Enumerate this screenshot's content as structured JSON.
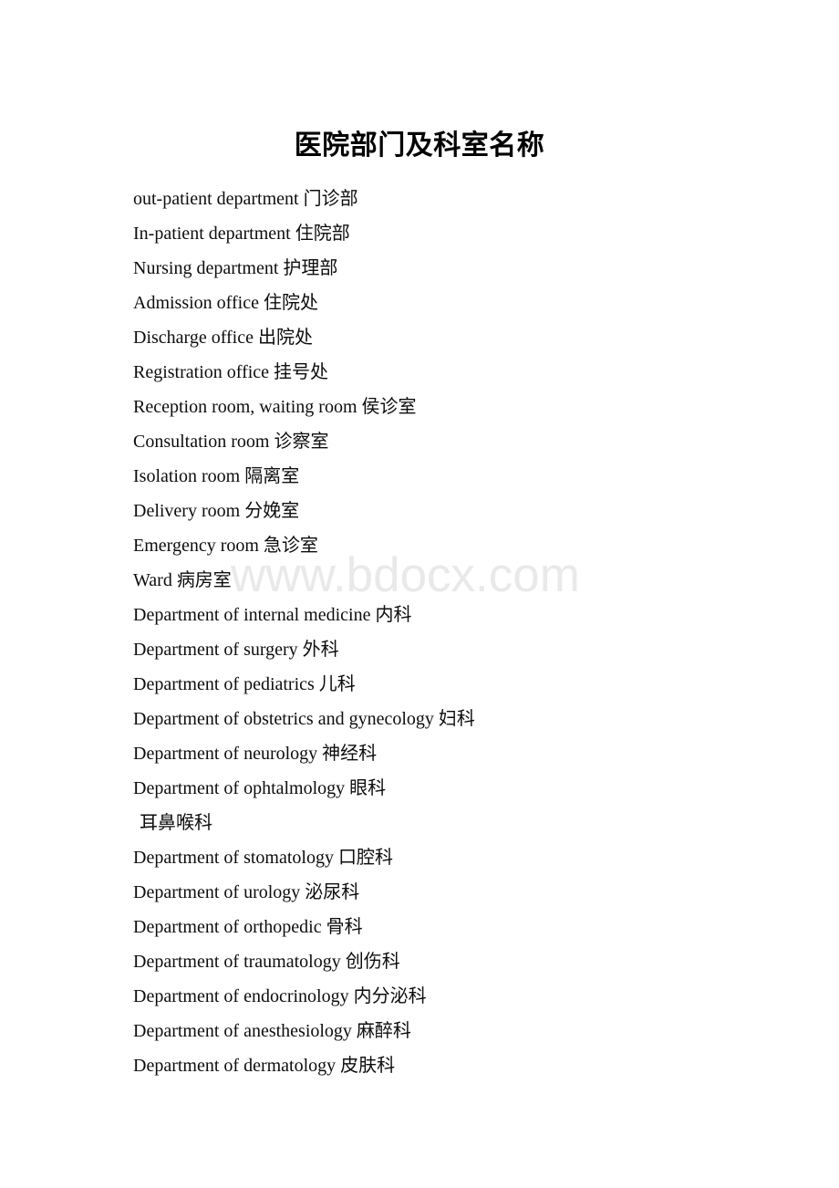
{
  "document": {
    "title": "医院部门及科室名称",
    "watermark": "www.bdocx.com",
    "lines": [
      {
        "text": "out-patient department 门诊部",
        "indent": false
      },
      {
        "text": "In-patient department 住院部",
        "indent": false
      },
      {
        "text": "Nursing department 护理部",
        "indent": false
      },
      {
        "text": "Admission office 住院处",
        "indent": false
      },
      {
        "text": "Discharge office 出院处",
        "indent": false
      },
      {
        "text": "Registration office 挂号处",
        "indent": false
      },
      {
        "text": "Reception room, waiting room 侯诊室",
        "indent": false
      },
      {
        "text": "Consultation room 诊察室",
        "indent": false
      },
      {
        "text": "Isolation room 隔离室",
        "indent": false
      },
      {
        "text": "Delivery room 分娩室",
        "indent": false
      },
      {
        "text": "Emergency room 急诊室",
        "indent": false
      },
      {
        "text": "Ward 病房室",
        "indent": false
      },
      {
        "text": "Department of internal medicine 内科",
        "indent": false
      },
      {
        "text": "Department of surgery 外科",
        "indent": false
      },
      {
        "text": "Department of pediatrics 儿科",
        "indent": false
      },
      {
        "text": "Department of obstetrics and gynecology 妇科",
        "indent": false
      },
      {
        "text": "Department of neurology 神经科",
        "indent": false
      },
      {
        "text": "Department of ophtalmology 眼科",
        "indent": false
      },
      {
        "text": "耳鼻喉科",
        "indent": true
      },
      {
        "text": "Department of stomatology 口腔科",
        "indent": false
      },
      {
        "text": "Department of urology 泌尿科",
        "indent": false
      },
      {
        "text": "Department of orthopedic 骨科",
        "indent": false
      },
      {
        "text": "Department of traumatology 创伤科",
        "indent": false
      },
      {
        "text": "Department of endocrinology 内分泌科",
        "indent": false
      },
      {
        "text": "Department of anesthesiology 麻醉科",
        "indent": false
      },
      {
        "text": "Department of dermatology 皮肤科",
        "indent": false
      }
    ]
  }
}
